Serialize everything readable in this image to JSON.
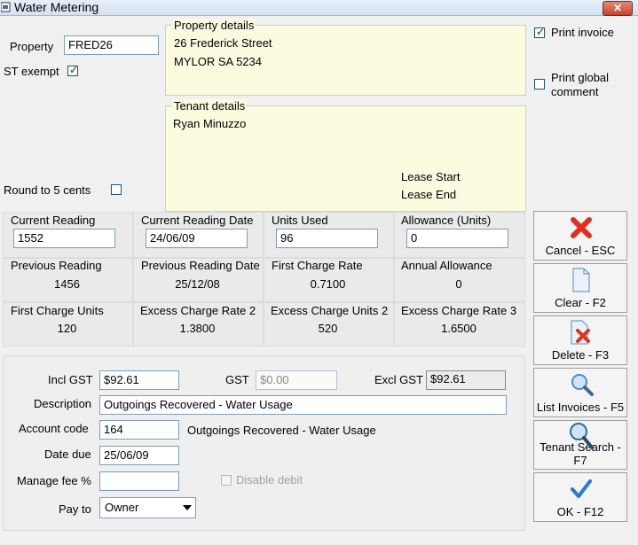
{
  "window": {
    "title": "Water Metering",
    "close_glyph": "✕"
  },
  "property": {
    "label": "Property",
    "value": "FRED26",
    "st_exempt_label": "ST exempt",
    "st_exempt": true,
    "round_label": "Round to 5 cents",
    "round": false
  },
  "property_details": {
    "title": "Property details",
    "line1": "26 Frederick Street",
    "line2": "MYLOR  SA  5234"
  },
  "tenant_details": {
    "title": "Tenant details",
    "name": "Ryan Minuzzo",
    "lease_start": "Lease Start",
    "lease_end": "Lease End"
  },
  "options": {
    "print_invoice_label": "Print invoice",
    "print_invoice": true,
    "print_global_label": "Print global comment",
    "print_global": false
  },
  "readings": {
    "current_reading_label": "Current Reading",
    "current_reading": "1552",
    "current_date_label": "Current Reading Date",
    "current_date": "24/06/09",
    "units_used_label": "Units Used",
    "units_used": "96",
    "allowance_label": "Allowance (Units)",
    "allowance": "0",
    "previous_reading_label": "Previous Reading",
    "previous_reading": "1456",
    "previous_date_label": "Previous Reading Date",
    "previous_date": "25/12/08",
    "first_rate_label": "First Charge Rate",
    "first_rate": "0.7100",
    "annual_allowance_label": "Annual Allowance",
    "annual_allowance": "0",
    "first_units_label": "First Charge Units",
    "first_units": "120",
    "excess_rate2_label": "Excess Charge Rate 2",
    "excess_rate2": "1.3800",
    "excess_units2_label": "Excess Charge Units 2",
    "excess_units2": "520",
    "excess_rate3_label": "Excess Charge Rate 3",
    "excess_rate3": "1.6500"
  },
  "charge": {
    "incl_gst_label": "Incl GST",
    "incl_gst": "$92.61",
    "gst_label": "GST",
    "gst": "$0.00",
    "excl_gst_label": "Excl GST",
    "excl_gst": "$92.61",
    "description_label": "Description",
    "description": "Outgoings Recovered - Water Usage",
    "account_code_label": "Account code",
    "account_code": "164",
    "account_name": "Outgoings Recovered - Water Usage",
    "date_due_label": "Date due",
    "date_due": "25/06/09",
    "manage_fee_label": "Manage fee %",
    "manage_fee": "",
    "disable_debit_label": "Disable debit",
    "pay_to_label": "Pay to",
    "pay_to": "Owner"
  },
  "buttons": {
    "cancel": "Cancel - ESC",
    "clear": "Clear - F2",
    "delete": "Delete - F3",
    "list_invoices": "List Invoices - F5",
    "tenant_search": "Tenant Search - F7",
    "ok": "OK - F12"
  },
  "colors": {
    "cancel_icon": "#e03020",
    "ok_icon": "#2a7bd0",
    "panel_yellow": "#fbfbe0"
  }
}
